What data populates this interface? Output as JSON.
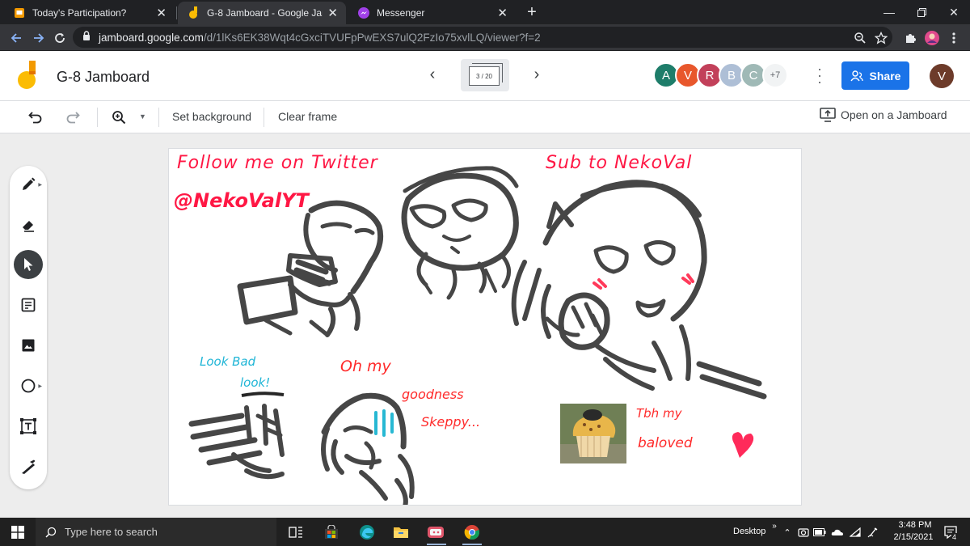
{
  "browser": {
    "tabs": [
      {
        "title": "Today's Participation?",
        "active": false
      },
      {
        "title": "G-8 Jamboard - Google Jamboar",
        "active": true
      },
      {
        "title": "Messenger",
        "active": false
      }
    ],
    "url_host": "jamboard.google.com",
    "url_path": "/d/1lKs6EK38Wqt4cGxciTVUFpPwEXS7ulQ2FzIo75xvlLQ/viewer?f=2"
  },
  "header": {
    "title": "G-8 Jamboard",
    "frame_indicator": "3 / 20",
    "avatars": [
      {
        "letter": "A",
        "color": "#1e7d6a"
      },
      {
        "letter": "V",
        "color": "#e8572c"
      },
      {
        "letter": "R",
        "color": "#c2405a"
      },
      {
        "letter": "B",
        "color": "#aebfd6"
      },
      {
        "letter": "C",
        "color": "#9fb9b6"
      }
    ],
    "more_count": "+7",
    "share_label": "Share",
    "user_initial": "V"
  },
  "toolbar": {
    "set_background": "Set background",
    "clear_frame": "Clear frame",
    "open_on_jamboard": "Open on a Jamboard"
  },
  "canvas": {
    "texts": {
      "follow": "Follow me on Twitter",
      "handle": "@NekoValYT",
      "sub": "Sub to NekoVal",
      "look": "Look Bad",
      "look2": "look!",
      "oh": "Oh my",
      "goodness": "goodness",
      "skeppy": "Skeppy...",
      "tbh": "Tbh  my",
      "beloved": "baloved"
    }
  },
  "taskbar": {
    "search_placeholder": "Type here to search",
    "desktop_label": "Desktop",
    "time": "3:48 PM",
    "date": "2/15/2021",
    "notification_count": "4"
  }
}
